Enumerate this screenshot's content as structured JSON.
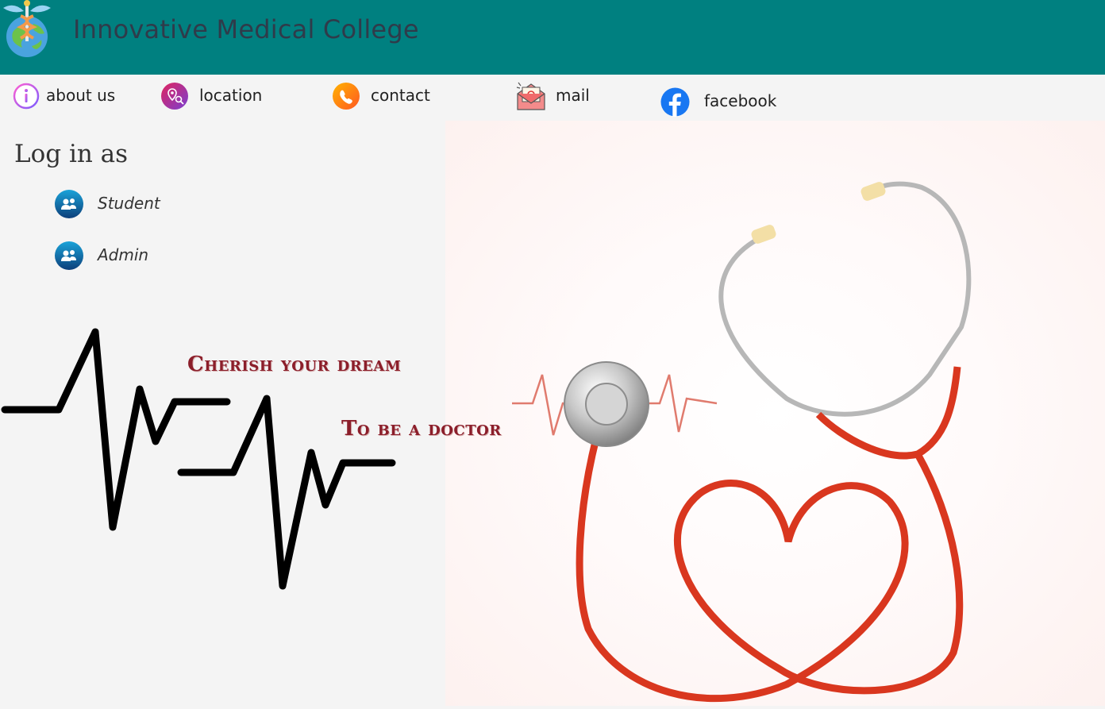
{
  "header": {
    "title": "Innovative Medical College",
    "background_color": "#008080",
    "logo_icon": "caduceus-globe-icon"
  },
  "nav": {
    "items": [
      {
        "label": "about us",
        "icon": "info-icon"
      },
      {
        "label": "location",
        "icon": "location-pin-icon"
      },
      {
        "label": "contact",
        "icon": "phone-icon"
      },
      {
        "label": "mail",
        "icon": "mail-envelope-icon"
      },
      {
        "label": "facebook",
        "icon": "facebook-icon"
      }
    ]
  },
  "login": {
    "heading": "Log in as",
    "roles": [
      {
        "label": "Student",
        "icon": "user-group-icon"
      },
      {
        "label": "Admin",
        "icon": "user-group-icon"
      }
    ]
  },
  "tagline": {
    "line1": "Cherish your dream",
    "line2": "To be a doctor",
    "color": "#8b1e2a"
  },
  "hero": {
    "image": "stethoscope-heart-illustration"
  }
}
